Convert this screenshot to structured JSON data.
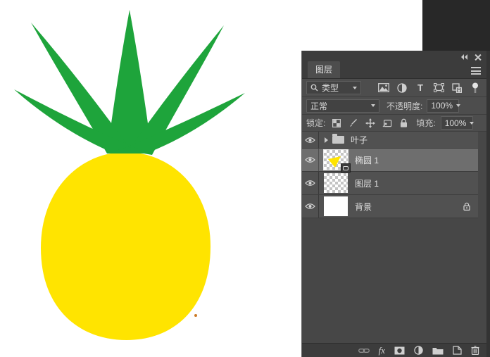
{
  "window": {
    "app_background_color": "#282828",
    "canvas_color": "#ffffff"
  },
  "pineapple": {
    "leaf_color": "#1ea43b",
    "body_color": "#ffe400",
    "speck_color": "#cc7a29"
  },
  "layers_panel": {
    "tab_label": "图层",
    "filter_bar": {
      "search_type_label": "类型",
      "type_filter_glyph": "T"
    },
    "blend_bar": {
      "blend_mode": "正常",
      "opacity_label": "不透明度:",
      "opacity_value": "100%"
    },
    "lock_bar": {
      "lock_label": "锁定:",
      "fill_label": "填充:",
      "fill_value": "100%"
    },
    "layers": [
      {
        "name": "叶子"
      },
      {
        "name": "椭圆 1"
      },
      {
        "name": "图层 1"
      },
      {
        "name": "背景"
      }
    ],
    "bottom_bar": {
      "fx_glyph": "fx"
    }
  }
}
